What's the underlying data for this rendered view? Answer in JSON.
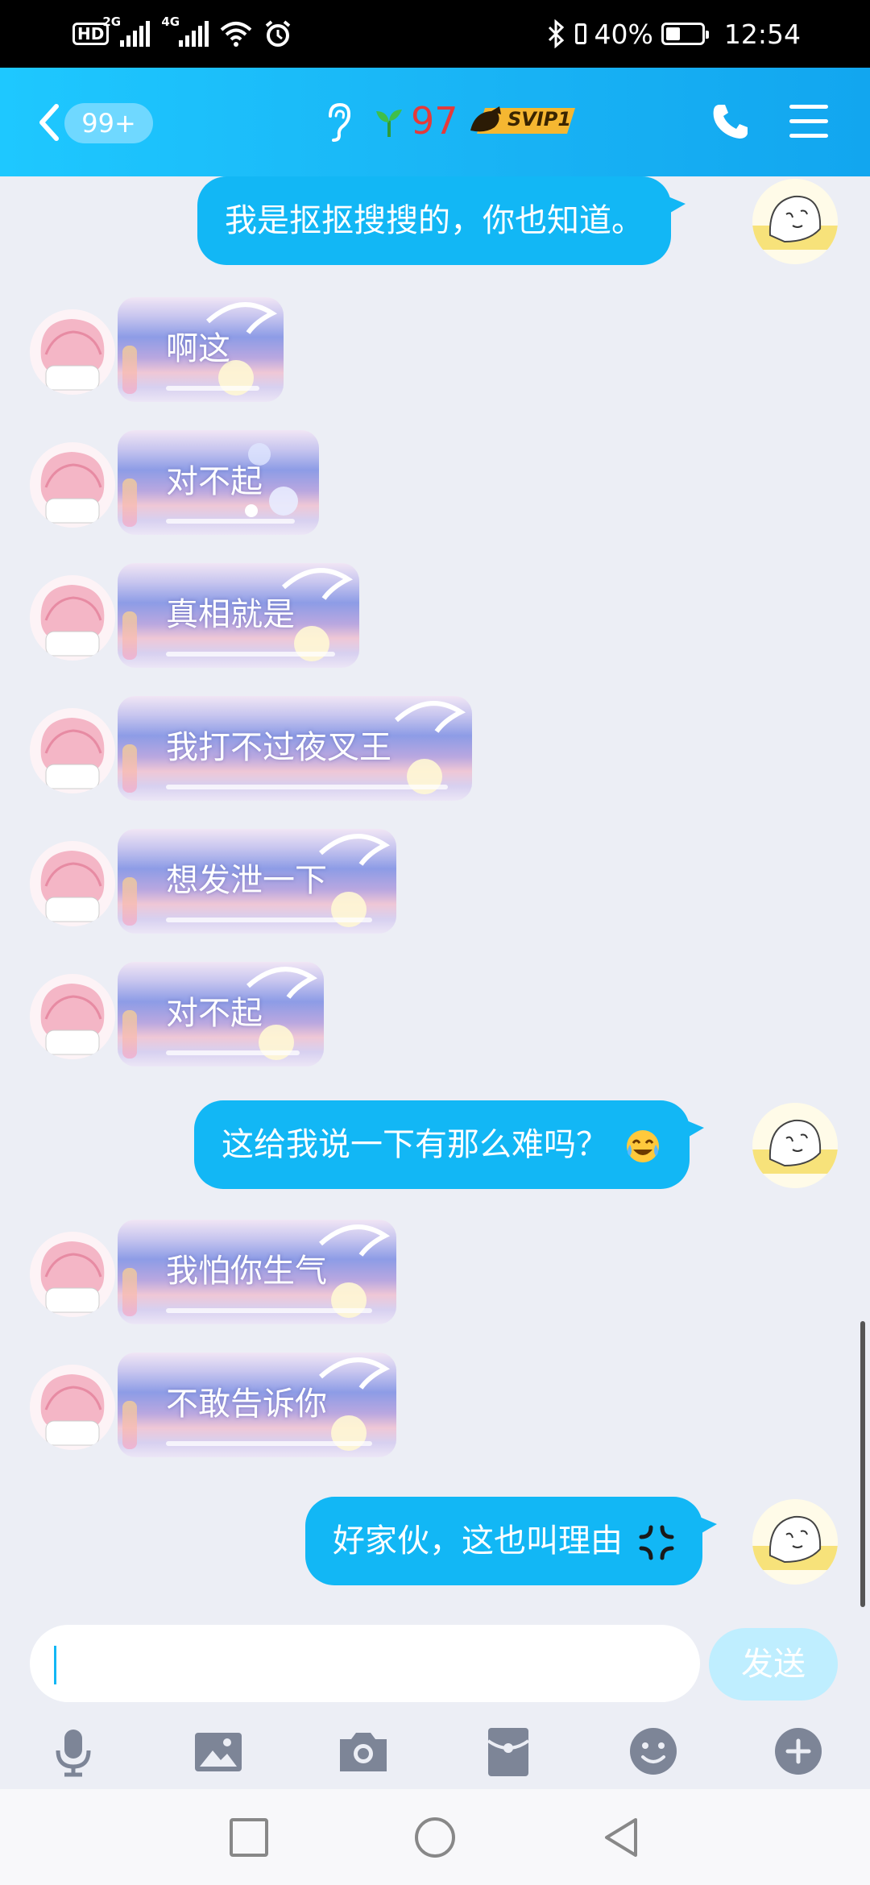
{
  "status_bar": {
    "hd_label": "HD",
    "sim1_tag": "2G",
    "sim2_tag": "4G",
    "battery_percent": "40%",
    "battery_level": 0.4,
    "time": "12:54"
  },
  "header": {
    "unread_badge": "99+",
    "level": "97",
    "vip_label": "SVIP1"
  },
  "messages": [
    {
      "from": "me",
      "text": "我是抠抠搜搜的，你也知道。"
    },
    {
      "from": "other",
      "text": "啊这"
    },
    {
      "from": "other",
      "text": "对不起"
    },
    {
      "from": "other",
      "text": "真相就是"
    },
    {
      "from": "other",
      "text": "我打不过夜叉王"
    },
    {
      "from": "other",
      "text": "想发泄一下"
    },
    {
      "from": "other",
      "text": "对不起"
    },
    {
      "from": "me",
      "text": "这给我说一下有那么难吗？",
      "emoji": "crying-laughing-emoji"
    },
    {
      "from": "other",
      "text": "我怕你生气"
    },
    {
      "from": "other",
      "text": "不敢告诉你"
    },
    {
      "from": "me",
      "text": "好家伙，这也叫理由",
      "emoji": "anger-symbol-emoji"
    }
  ],
  "input": {
    "value": "",
    "send_label": "发送"
  },
  "toolbar": [
    "microphone-icon",
    "image-icon",
    "camera-icon",
    "red-packet-icon",
    "emoji-icon",
    "plus-icon"
  ],
  "colors": {
    "accent": "#12b7f5",
    "header_start": "#1ec8ff",
    "header_end": "#12a6ef",
    "chat_background": "#eceef5",
    "level_red": "#e53a3a"
  }
}
